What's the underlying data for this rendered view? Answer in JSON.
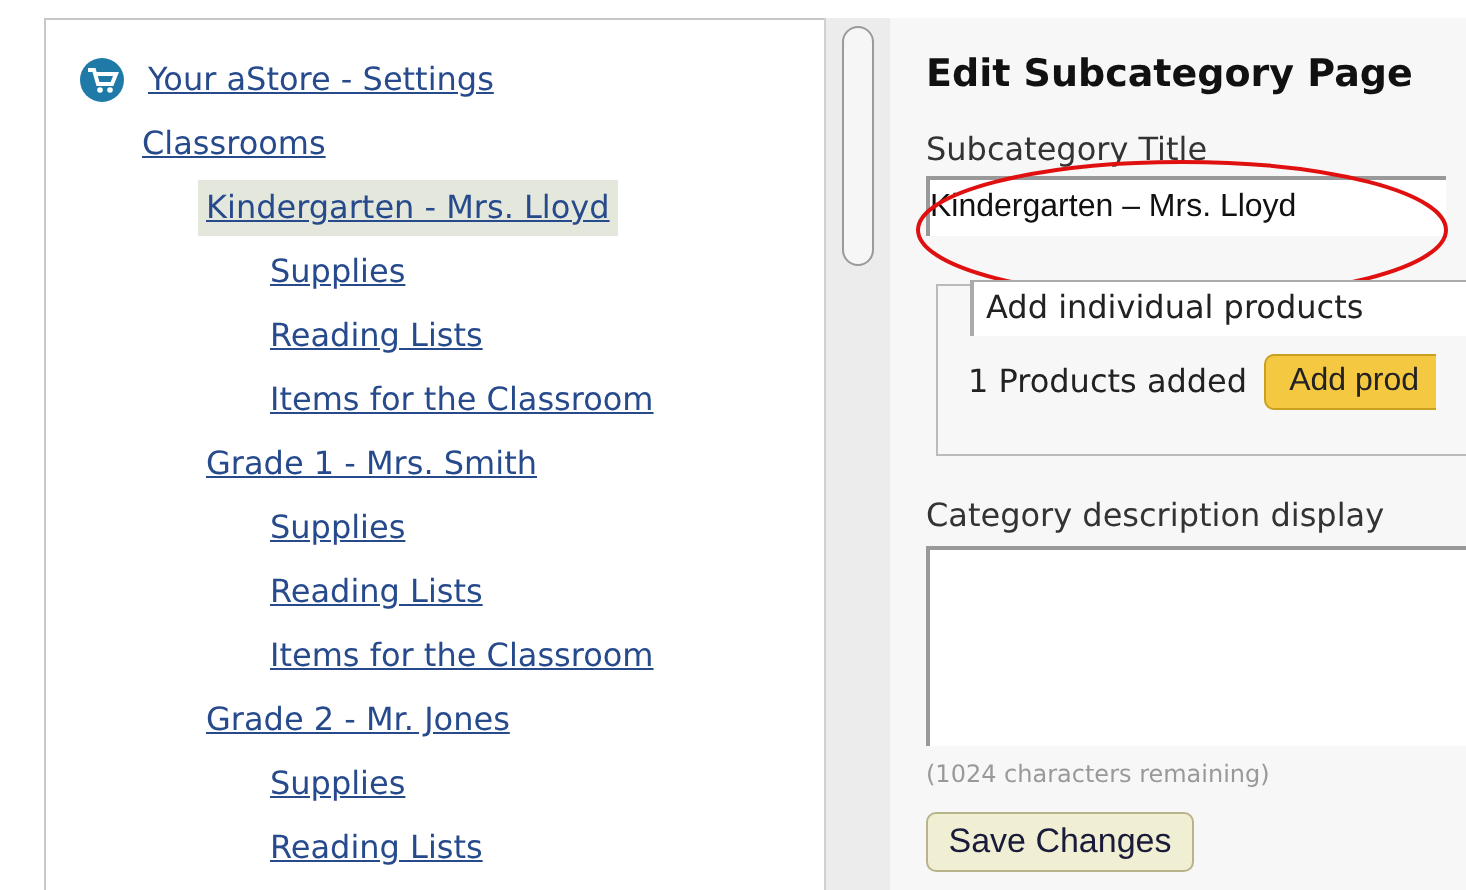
{
  "tree": [
    {
      "label": "Your aStore - Settings",
      "kind": "store",
      "selected": false
    },
    {
      "label": "Classrooms",
      "selected": false,
      "children": [
        {
          "label": "Kindergarten - Mrs. Lloyd",
          "selected": true,
          "children": [
            {
              "label": "Supplies",
              "selected": false
            },
            {
              "label": "Reading Lists",
              "selected": false
            },
            {
              "label": "Items for the Classroom",
              "selected": false
            }
          ]
        },
        {
          "label": "Grade 1 - Mrs. Smith",
          "selected": false,
          "children": [
            {
              "label": "Supplies",
              "selected": false
            },
            {
              "label": "Reading Lists",
              "selected": false
            },
            {
              "label": "Items for the Classroom",
              "selected": false
            }
          ]
        },
        {
          "label": "Grade 2 - Mr. Jones",
          "selected": false,
          "children": [
            {
              "label": "Supplies",
              "selected": false
            },
            {
              "label": "Reading Lists",
              "selected": false
            }
          ]
        }
      ]
    }
  ],
  "editor": {
    "heading": "Edit Subcategory Page",
    "title_label": "Subcategory Title",
    "title_value": "Kindergarten – Mrs. Lloyd",
    "highlighted": true,
    "product_mode": "Add individual products",
    "products_added": "1 Products added",
    "add_button": "Add prod",
    "description_label": "Category description display",
    "remaining": "(1024 characters remaining)",
    "save_button": "Save Changes"
  }
}
